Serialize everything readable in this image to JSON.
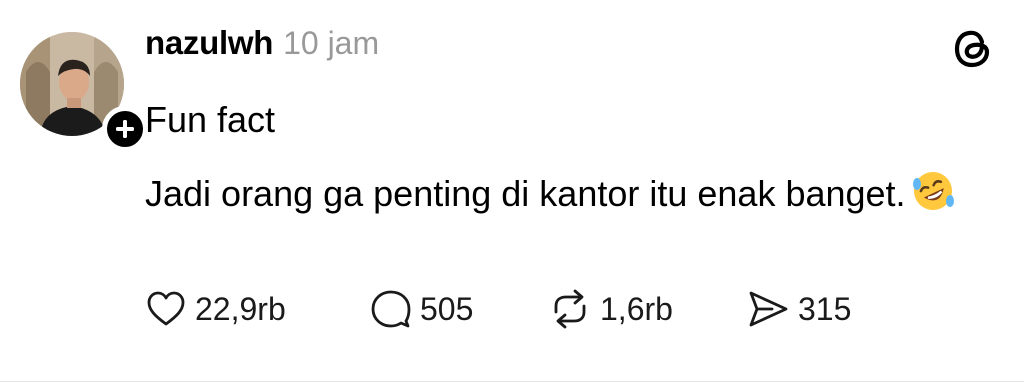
{
  "post": {
    "username": "nazulwh",
    "time": "10 jam",
    "text_line1": "Fun fact",
    "text_line2": "Jadi orang ga penting di kantor itu enak banget.",
    "emoji_icon": "rolling-on-floor-laughing-emoji"
  },
  "actions": {
    "likes": "22,9rb",
    "replies": "505",
    "reposts": "1,6rb",
    "shares": "315"
  },
  "icons": {
    "brand": "threads-logo-icon",
    "follow": "plus-icon",
    "like": "heart-icon",
    "reply": "comment-bubble-icon",
    "repost": "repost-icon",
    "share": "send-icon"
  },
  "colors": {
    "text": "#000000",
    "muted": "#999999",
    "emoji": "#FFC83D"
  }
}
